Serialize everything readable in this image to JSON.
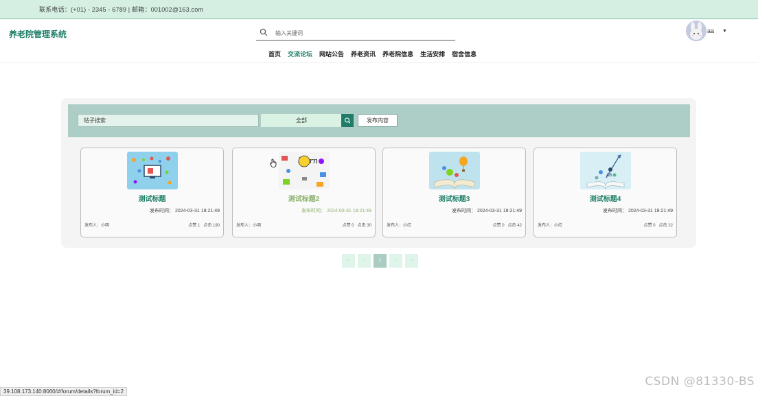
{
  "topbar": {
    "contact": "联系电话：(+01) - 2345 - 6789  |  邮箱：001002@163.com"
  },
  "header": {
    "brand": "养老院管理系统",
    "search_placeholder": "输入关键词",
    "username": "aa"
  },
  "nav": {
    "items": [
      {
        "label": "首页"
      },
      {
        "label": "交流论坛",
        "active": true
      },
      {
        "label": "网站公告"
      },
      {
        "label": "养老资讯"
      },
      {
        "label": "养老院信息"
      },
      {
        "label": "生活安排"
      },
      {
        "label": "宿舍信息"
      }
    ]
  },
  "filter": {
    "search_value": "帖子搜索",
    "select_value": "全部",
    "publish_label": "发布内容"
  },
  "cards": [
    {
      "title": "测试标题",
      "time_label": "发布时间：",
      "time": "2024-03-31 18:21:49",
      "author": "发布人：小明",
      "likes": "点赞 1",
      "views": "点击 190"
    },
    {
      "title": "测试标题2",
      "time_label": "发布时间：",
      "time": "2024-03-31 18:21:49",
      "author": "发布人：小明",
      "likes": "点赞 0",
      "views": "点击 30"
    },
    {
      "title": "测试标题3",
      "time_label": "发布时间：",
      "time": "2024-03-31 18:21:49",
      "author": "发布人：小红",
      "likes": "点赞 0",
      "views": "点击 42"
    },
    {
      "title": "测试标题4",
      "time_label": "发布时间：",
      "time": "2024-03-31 18:21:49",
      "author": "发布人：小红",
      "likes": "点赞 0",
      "views": "点击 22"
    }
  ],
  "pager": {
    "first": "«",
    "prev": "‹",
    "current": "1",
    "next": "›",
    "last": "»"
  },
  "statusbar": {
    "url": "39.108.173.140:8060/#/forum/details?forum_id=2"
  },
  "watermark": "CSDN @81330-BS",
  "colors": {
    "accent": "#1e7f68",
    "topbar": "#d5efe3",
    "filterbar": "#adcec6",
    "hover_title": "#8db26e"
  }
}
